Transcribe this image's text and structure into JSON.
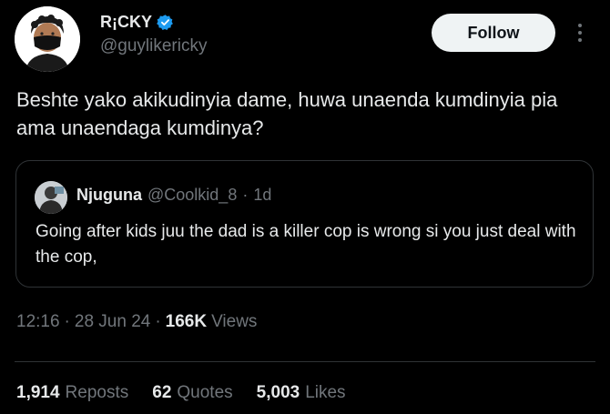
{
  "author": {
    "name": "R¡CKY",
    "handle": "@guylikericky"
  },
  "actions": {
    "follow_label": "Follow"
  },
  "tweet": {
    "text": "Beshte yako akikudinyia dame, huwa unaenda kumdinyia pia ama unaendaga kumdinya?"
  },
  "quote": {
    "name": "Njuguna",
    "handle": "@Coolkid_8",
    "separator": "·",
    "time": "1d",
    "text": "Going after kids juu the dad is a killer cop is wrong si you  just deal with the cop,"
  },
  "meta": {
    "time": "12:16",
    "sep1": "·",
    "date": "28 Jun 24",
    "sep2": "·",
    "views_count": "166K",
    "views_label": "Views"
  },
  "stats": {
    "reposts_count": "1,914",
    "reposts_label": "Reposts",
    "quotes_count": "62",
    "quotes_label": "Quotes",
    "likes_count": "5,003",
    "likes_label": "Likes"
  },
  "icons": {
    "verified": "verified-badge-icon",
    "more": "more-vertical-icon"
  },
  "colors": {
    "background": "#000000",
    "text_primary": "#e7e9ea",
    "text_secondary": "#71767b",
    "verified_blue": "#1d9bf0",
    "border": "#2f3336",
    "follow_bg": "#eff3f4"
  }
}
